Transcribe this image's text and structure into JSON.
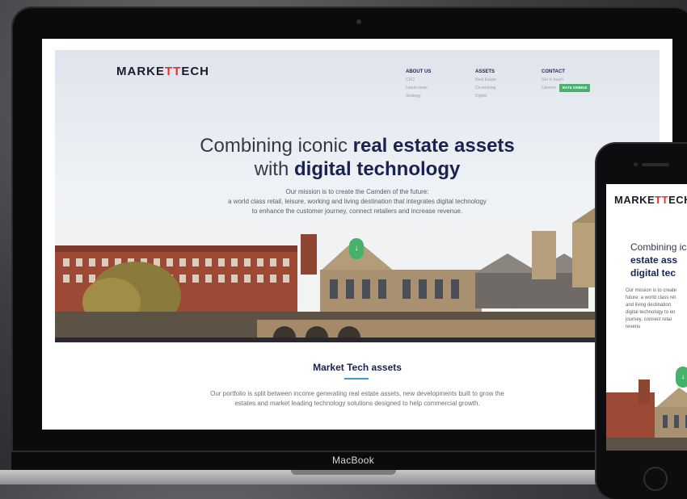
{
  "laptop": {
    "brand_label": "MacBook"
  },
  "site": {
    "logo": {
      "part1": "MARKE",
      "part2": "TT",
      "part3": "ECH"
    },
    "nav": [
      {
        "heading": "ABOUT US",
        "items": [
          "CEO",
          "Latest news",
          "Strategy"
        ]
      },
      {
        "heading": "ASSETS",
        "items": [
          "Real Estate",
          "Co-working",
          "Digital"
        ]
      },
      {
        "heading": "CONTACT",
        "items": [
          "Get in touch",
          "Careers"
        ],
        "cta": "RATE ONBIKE"
      }
    ],
    "hero": {
      "line1_plain": "Combining iconic ",
      "line1_bold": "real estate assets",
      "line2_plain": "with ",
      "line2_bold": "digital technology",
      "mission_lines": [
        "Our mission is to create the Camden of the future:",
        "a world class retail, leisure, working and living destination that integrates digital technology",
        "to enhance the customer journey, connect retailers and increase revenue."
      ],
      "scroll_icon": "chevron-down-icon"
    },
    "assets_section": {
      "title": "Market Tech assets",
      "text_lines": [
        "Our portfolio is split between income generating real estate assets, new developments built to grow the",
        "estates and market leading technology solutions designed to help commercial growth."
      ]
    }
  },
  "phone": {
    "logo": {
      "part1": "MARKE",
      "part2": "TT",
      "part3": "ECH"
    },
    "headline_line1": "Combining ic",
    "headline_line2": "estate ass",
    "headline_line3": "digital tec",
    "mission_lines": [
      "Our mission is to create",
      "future: a world class ret",
      "and living destination",
      "digital technology to en",
      "journey, connect retai",
      "revenu"
    ]
  },
  "colors": {
    "brand_navy": "#1b2250",
    "brand_red": "#e7302a",
    "cta_green": "#46b168",
    "accent_blue": "#3d9bd6"
  }
}
